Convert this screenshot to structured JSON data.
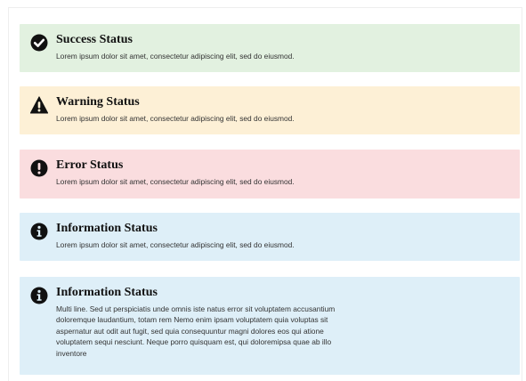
{
  "alerts": [
    {
      "type": "success",
      "icon": "check-circle-icon",
      "title": "Success Status",
      "text": "Lorem ipsum dolor sit amet, consectetur adipiscing elit, sed do eiusmod.",
      "color": "#e2f1e0"
    },
    {
      "type": "warning",
      "icon": "warning-triangle-icon",
      "title": "Warning Status",
      "text": "Lorem ipsum dolor sit amet, consectetur adipiscing elit, sed do eiusmod.",
      "color": "#fdf0d6"
    },
    {
      "type": "error",
      "icon": "exclamation-circle-icon",
      "title": "Error Status",
      "text": "Lorem ipsum dolor sit amet, consectetur adipiscing elit, sed do eiusmod.",
      "color": "#fadddf"
    },
    {
      "type": "info",
      "icon": "info-circle-icon",
      "title": "Information Status",
      "text": "Lorem ipsum dolor sit amet, consectetur adipiscing elit, sed do eiusmod.",
      "color": "#deeff8"
    },
    {
      "type": "info",
      "icon": "info-circle-icon",
      "title": "Information Status",
      "text": "Multi line. Sed ut perspiciatis unde omnis iste natus error sit voluptatem accusantium doloremque laudantium, totam rem Nemo enim ipsam voluptatem quia voluptas sit aspernatur aut odit aut fugit, sed quia consequuntur magni dolores eos qui atione voluptatem sequi nesciunt. Neque porro quisquam est, qui doloremipsa quae ab illo inventore",
      "color": "#deeff8"
    }
  ]
}
